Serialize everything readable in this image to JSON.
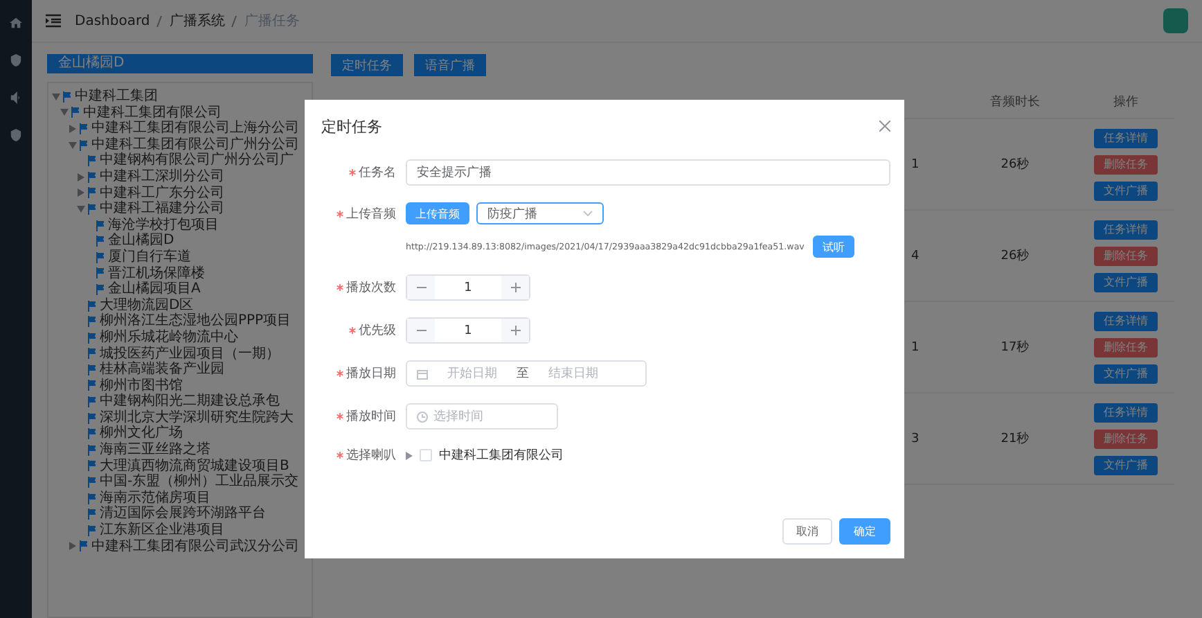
{
  "breadcrumb": [
    "Dashboard",
    "广播系统",
    "广播任务"
  ],
  "project_select": {
    "value": "金山橘园D"
  },
  "toolbar": [
    "定时任务",
    "语音广播"
  ],
  "tree": [
    {
      "label": "中建科工集团",
      "expanded": true,
      "children": [
        {
          "label": "中建科工集团有限公司",
          "expanded": true,
          "children": [
            {
              "label": "中建科工集团有限公司上海分公司",
              "expanded": false
            },
            {
              "label": "中建科工集团有限公司广州分公司",
              "expanded": true,
              "children": [
                {
                  "label": "中建钢构有限公司广州分公司广"
                },
                {
                  "label": "中建科工深圳分公司",
                  "expanded": false
                },
                {
                  "label": "中建科工广东分公司",
                  "expanded": false
                },
                {
                  "label": "中建科工福建分公司",
                  "expanded": true,
                  "children": [
                    {
                      "label": "海沧学校打包项目"
                    },
                    {
                      "label": "金山橘园D"
                    },
                    {
                      "label": "厦门自行车道"
                    },
                    {
                      "label": "晋江机场保障楼"
                    },
                    {
                      "label": "金山橘园项目A"
                    }
                  ]
                },
                {
                  "label": "大理物流园D区"
                },
                {
                  "label": "柳州洛江生态湿地公园PPP项目"
                },
                {
                  "label": "柳州乐城花岭物流中心"
                },
                {
                  "label": "城投医药产业园项目（一期）"
                },
                {
                  "label": "桂林高端装备产业园"
                },
                {
                  "label": "柳州市图书馆"
                },
                {
                  "label": "中建钢构阳光二期建设总承包"
                },
                {
                  "label": "深圳北京大学深圳研究生院跨大"
                },
                {
                  "label": "柳州文化广场"
                },
                {
                  "label": "海南三亚丝路之塔"
                },
                {
                  "label": "大理滇西物流商贸城建设项目B"
                },
                {
                  "label": "中国-东盟（柳州）工业品展示交"
                },
                {
                  "label": "海南示范储房项目"
                },
                {
                  "label": "清迈国际会展跨环湖路平台"
                },
                {
                  "label": "江东新区企业港项目"
                }
              ]
            },
            {
              "label": "中建科工集团有限公司武汉分公司",
              "expanded": false
            }
          ]
        }
      ]
    }
  ],
  "table": {
    "columns": [
      "音频时长",
      "操作"
    ],
    "rows": [
      {
        "count": "1",
        "duration": "26秒",
        "actions": [
          {
            "kind": "detail",
            "label": "任务详情"
          },
          {
            "kind": "delete",
            "label": "删除任务"
          },
          {
            "kind": "broadcast",
            "label": "文件广播"
          }
        ]
      },
      {
        "count": "4",
        "duration": "26秒",
        "actions": [
          {
            "kind": "detail",
            "label": "任务详情"
          },
          {
            "kind": "delete",
            "label": "删除任务"
          },
          {
            "kind": "broadcast",
            "label": "文件广播"
          }
        ]
      },
      {
        "count": "1",
        "duration": "17秒",
        "actions": [
          {
            "kind": "detail",
            "label": "任务详情"
          },
          {
            "kind": "delete",
            "label": "删除任务"
          },
          {
            "kind": "broadcast",
            "label": "文件广播"
          }
        ]
      },
      {
        "count": "3",
        "duration": "21秒",
        "actions": [
          {
            "kind": "detail",
            "label": "任务详情"
          },
          {
            "kind": "delete",
            "label": "删除任务"
          },
          {
            "kind": "broadcast",
            "label": "文件广播"
          }
        ]
      }
    ]
  },
  "dialog": {
    "title": "定时任务",
    "task_name": {
      "label": "任务名",
      "required": true,
      "value": "安全提示广播"
    },
    "audio": {
      "label": "上传音频",
      "required": true,
      "upload_button": "上传音频",
      "select_value": "防疫广播",
      "url": "http://219.134.89.13:8082/images/2021/04/17/2939aaa3829a42dc91dcbba29a1fea51.wav",
      "listen_button": "试听"
    },
    "play_count": {
      "label": "播放次数",
      "required": true,
      "value": "1"
    },
    "priority": {
      "label": "优先级",
      "required": true,
      "value": "1"
    },
    "play_date": {
      "label": "播放日期",
      "required": true,
      "start_placeholder": "开始日期",
      "separator": "至",
      "end_placeholder": "结束日期"
    },
    "play_time": {
      "label": "播放时间",
      "required": true,
      "placeholder": "选择时间"
    },
    "speakers": {
      "label": "选择喇叭",
      "required": true,
      "items": [
        {
          "label": "中建科工集团有限公司",
          "expanded": false,
          "checked": false
        }
      ]
    },
    "buttons": {
      "cancel": "取消",
      "confirm": "确定"
    }
  }
}
